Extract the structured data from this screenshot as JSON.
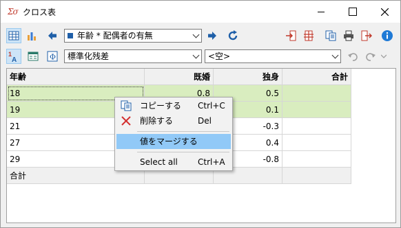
{
  "window": {
    "title": "クロス表",
    "app_icon": "Σσ"
  },
  "toolbar": {
    "variable_combo": "年齢 * 配偶者の有無",
    "stat_combo": "標準化残差",
    "filter_combo": "<空>"
  },
  "table": {
    "headers": [
      "年齢",
      "既婚",
      "独身",
      "合計"
    ],
    "rows": [
      [
        "18",
        "0.8",
        "0.5",
        ""
      ],
      [
        "19",
        "",
        "0.1",
        ""
      ],
      [
        "21",
        "",
        "-0.3",
        ""
      ],
      [
        "27",
        "",
        "0.4",
        ""
      ],
      [
        "29",
        "",
        "-0.8",
        ""
      ],
      [
        "合計",
        "",
        "",
        ""
      ]
    ]
  },
  "context_menu": {
    "items": [
      {
        "label": "コピーする",
        "shortcut": "Ctrl+C",
        "icon": "copy-icon"
      },
      {
        "label": "削除する",
        "shortcut": "Del",
        "icon": "delete-icon"
      },
      {
        "label": "値をマージする",
        "shortcut": "",
        "icon": ""
      },
      {
        "label": "Select all",
        "shortcut": "Ctrl+A",
        "icon": ""
      }
    ]
  },
  "colors": {
    "highlight_row": "#d9edbf",
    "menu_hover": "#91c9f7",
    "accent": "#1f5fa8"
  }
}
